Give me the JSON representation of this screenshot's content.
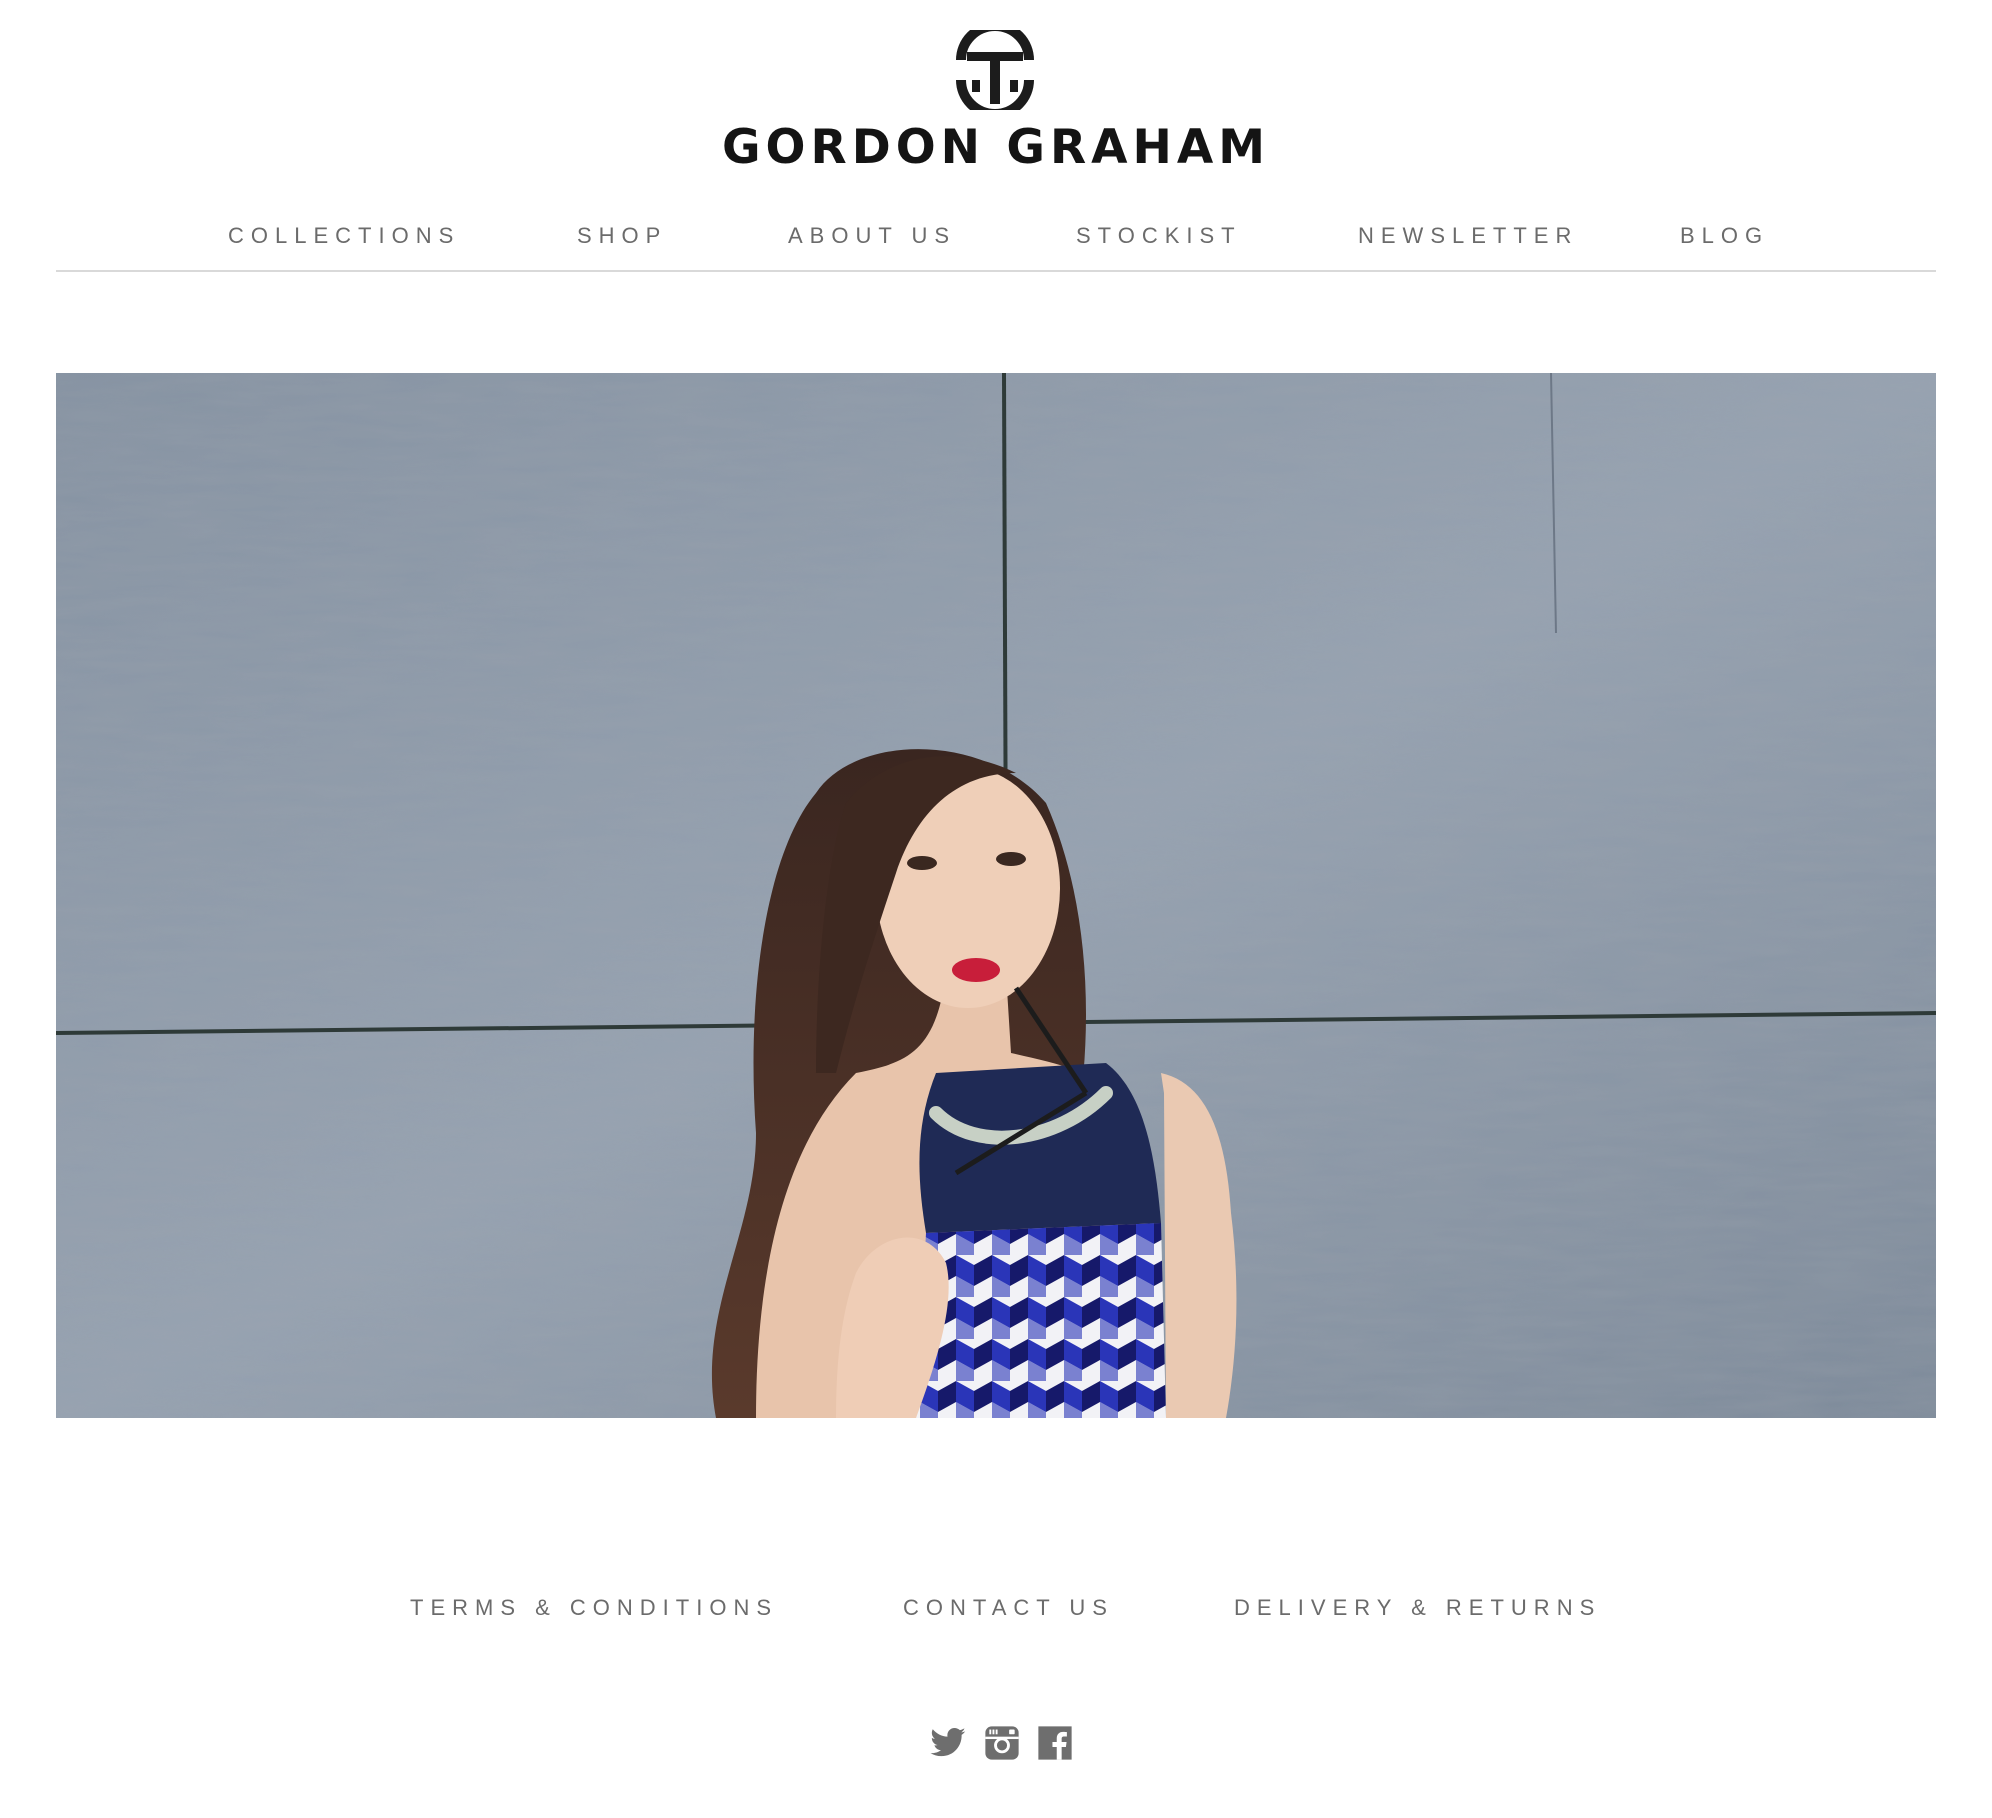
{
  "brand": {
    "name": "GORDON GRAHAM",
    "logo_icon": "gg-monogram-logo"
  },
  "nav": {
    "items": [
      {
        "label": "COLLECTIONS"
      },
      {
        "label": "SHOP"
      },
      {
        "label": "ABOUT US"
      },
      {
        "label": "STOCKIST"
      },
      {
        "label": "NEWSLETTER"
      },
      {
        "label": "BLOG"
      }
    ]
  },
  "hero": {
    "image": "model-with-sunglasses-against-concrete-wall"
  },
  "footer": {
    "links": [
      {
        "label": "TERMS & CONDITIONS"
      },
      {
        "label": "CONTACT US"
      },
      {
        "label": "DELIVERY & RETURNS"
      }
    ],
    "social": [
      {
        "icon": "twitter-icon"
      },
      {
        "icon": "instagram-icon"
      },
      {
        "icon": "facebook-icon"
      }
    ]
  },
  "colors": {
    "text": "#6b6b6b",
    "brand": "#141414",
    "divider": "#d9d9d9"
  }
}
